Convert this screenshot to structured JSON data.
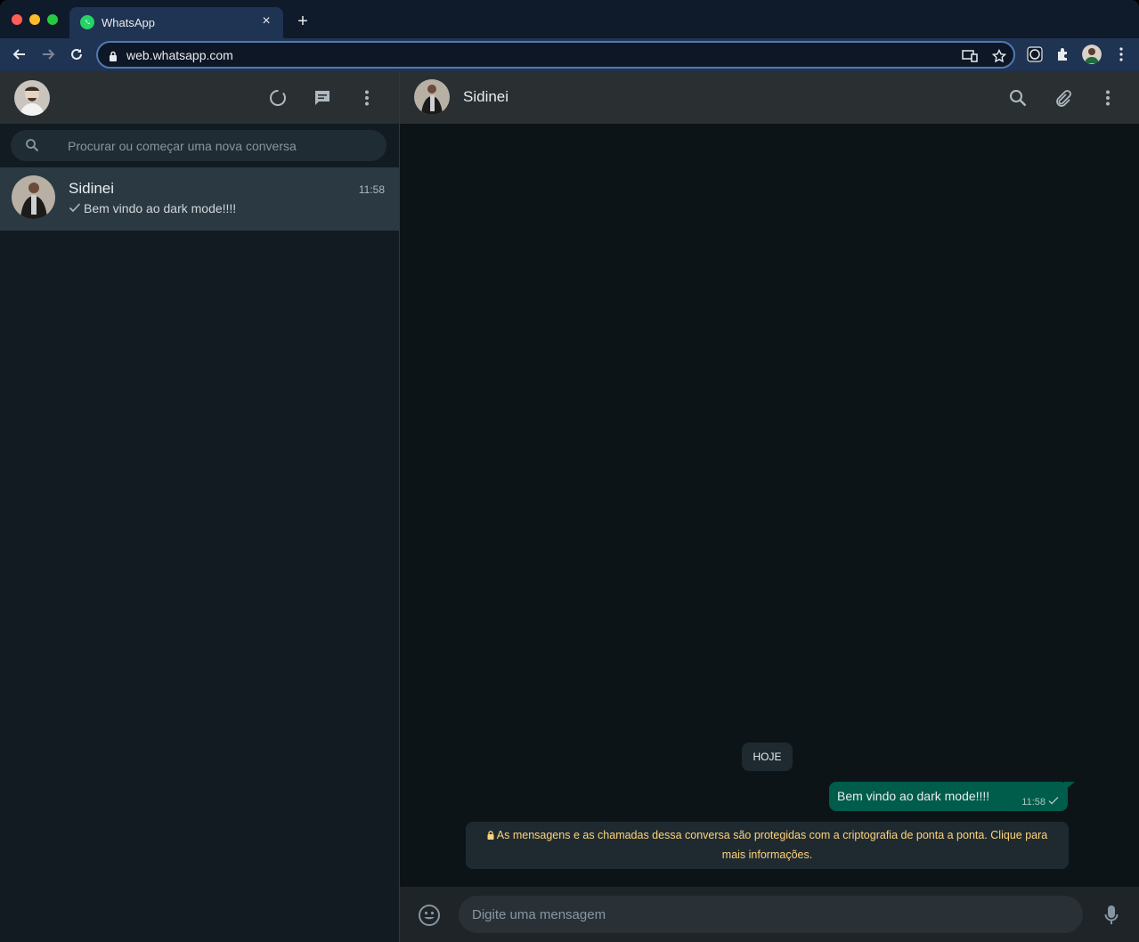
{
  "browser": {
    "tab_title": "WhatsApp",
    "close_glyph": "×",
    "new_tab_glyph": "+",
    "url": "web.whatsapp.com"
  },
  "sidebar": {
    "search_placeholder": "Procurar ou começar uma nova conversa",
    "chats": [
      {
        "name": "Sidinei",
        "time": "11:58",
        "preview": "Bem vindo ao dark mode!!!!"
      }
    ]
  },
  "conversation": {
    "contact_name": "Sidinei",
    "date_divider": "HOJE",
    "messages": [
      {
        "text": "Bem vindo ao dark mode!!!!",
        "time": "11:58",
        "outgoing": true
      }
    ],
    "encryption_notice": "As mensagens e as chamadas dessa conversa são protegidas com a criptografia de ponta a ponta. Clique para mais informações.",
    "compose_placeholder": "Digite uma mensagem"
  },
  "colors": {
    "accent_green": "#00a884",
    "bubble_outgoing": "#005c4b",
    "notice_text": "#ffd279"
  },
  "icons": [
    "whatsapp-icon",
    "back-icon",
    "forward-icon",
    "reload-icon",
    "lock-icon",
    "cast-icon",
    "star-icon",
    "puzzle-icon",
    "kebab-icon",
    "status-icon",
    "new-chat-icon",
    "search-icon",
    "attach-icon",
    "emoji-icon",
    "mic-icon",
    "check-icon"
  ]
}
